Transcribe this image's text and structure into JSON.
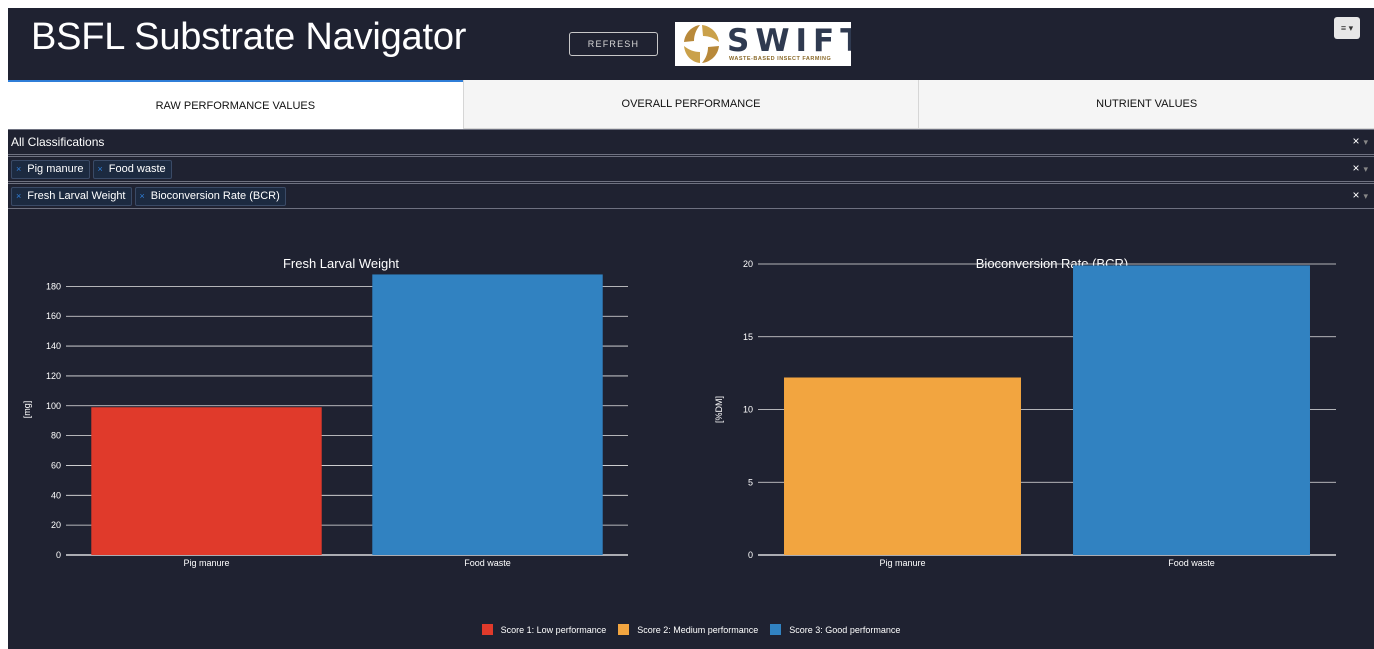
{
  "header": {
    "title": "BSFL Substrate Navigator",
    "refresh_label": "REFRESH",
    "logo_word": "SWIFT",
    "logo_sub": "WASTE-BASED INSECT FARMING",
    "menu_label": "≡ ▾"
  },
  "tabs": [
    {
      "label": "RAW PERFORMANCE VALUES",
      "active": true
    },
    {
      "label": "OVERALL PERFORMANCE",
      "active": false
    },
    {
      "label": "NUTRIENT VALUES",
      "active": false
    }
  ],
  "filters": {
    "classification": "All Classifications",
    "substrates": [
      "Pig manure",
      "Food waste"
    ],
    "metrics": [
      "Fresh Larval Weight",
      "Bioconversion Rate (BCR)"
    ],
    "clear_symbol": "×",
    "arrow_symbol": "▾",
    "chip_x_symbol": "×"
  },
  "colors": {
    "score1": "#e03a2b",
    "score2": "#f2a540",
    "score3": "#3182c1"
  },
  "chart_data": [
    {
      "type": "bar",
      "title": "Fresh Larval Weight",
      "ylabel": "[mg]",
      "categories": [
        "Pig manure",
        "Food waste"
      ],
      "values": [
        99,
        188
      ],
      "scores": [
        1,
        3
      ],
      "ylim": [
        0,
        195
      ],
      "yticks": [
        0,
        20,
        40,
        60,
        80,
        100,
        120,
        140,
        160,
        180
      ]
    },
    {
      "type": "bar",
      "title": "Bioconversion Rate (BCR)",
      "ylabel": "[%DM]",
      "categories": [
        "Pig manure",
        "Food waste"
      ],
      "values": [
        12.2,
        19.9
      ],
      "scores": [
        2,
        3
      ],
      "ylim": [
        0,
        20
      ],
      "yticks": [
        0,
        5,
        10,
        15,
        20
      ]
    }
  ],
  "legend": [
    {
      "label": "Score 1: Low performance",
      "color": "#e03a2b"
    },
    {
      "label": "Score 2: Medium performance",
      "color": "#f2a540"
    },
    {
      "label": "Score 3: Good performance",
      "color": "#3182c1"
    }
  ]
}
